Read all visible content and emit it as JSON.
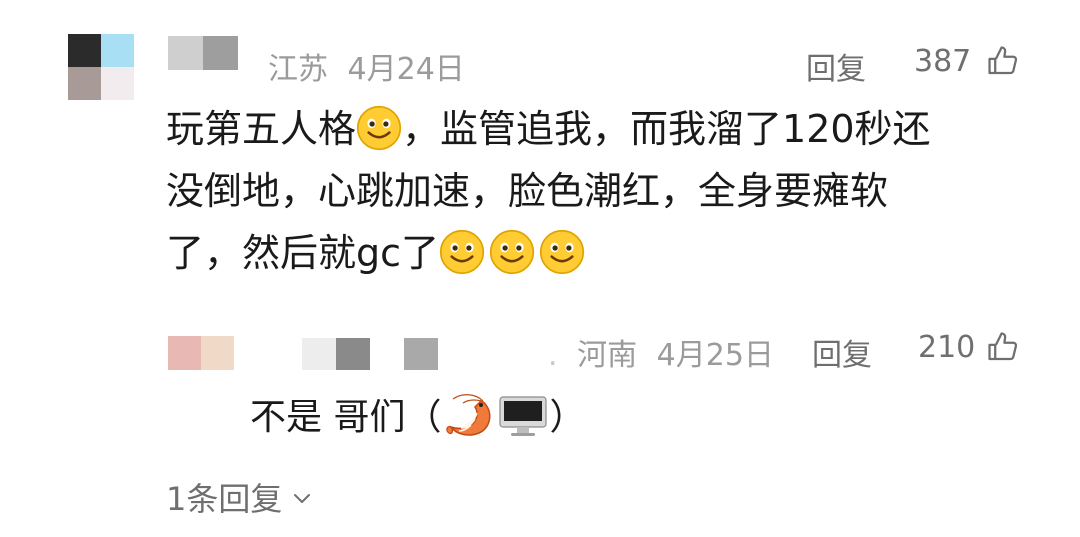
{
  "comment": {
    "location": "江苏",
    "date": "4月24日",
    "reply_label": "回复",
    "likes": "387",
    "lines": [
      {
        "segments": [
          "玩第五人格",
          "smile",
          "，监管追我，而我溜了120秒还"
        ]
      },
      {
        "segments": [
          "没倒地，心跳加速，脸色潮红，全身要瘫软"
        ]
      },
      {
        "segments": [
          "了，然后就gc了",
          "smile",
          "smile",
          "smile"
        ]
      }
    ],
    "line1_a": "玩第五人格",
    "line1_b": "，监管追我，而我溜了120秒还",
    "line2": "没倒地，心跳加速，脸色潮红，全身要瘫软",
    "line3": "了，然后就gc了"
  },
  "reply": {
    "location": "河南",
    "date": "4月25日",
    "reply_label": "回复",
    "likes": "210",
    "text_a": "不是 哥们（",
    "text_b": "）",
    "icons": [
      "shrimp-emoji",
      "computer-emoji"
    ]
  },
  "more_replies": {
    "label": "1条回复"
  },
  "colors": {
    "meta": "#9b9b9b",
    "action": "#6f6f6f",
    "text": "#1a1a1a",
    "emoji_yellow": "#ffcc33",
    "shrimp": "#f07a3a"
  }
}
